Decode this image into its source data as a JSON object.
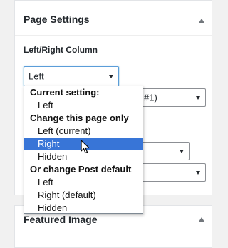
{
  "page_settings": {
    "title": "Page Settings",
    "column_label": "Left/Right Column",
    "column_select_value": "Left",
    "template_select_value": "#1)"
  },
  "dropdown": {
    "groups": [
      {
        "label": "Current setting:",
        "options": [
          {
            "label": "Left",
            "highlighted": false
          }
        ]
      },
      {
        "label": "Change this page only",
        "options": [
          {
            "label": "Left (current)",
            "highlighted": false
          },
          {
            "label": "Right",
            "highlighted": true
          },
          {
            "label": "Hidden",
            "highlighted": false
          }
        ]
      },
      {
        "label": "Or change Post default",
        "options": [
          {
            "label": "Left",
            "highlighted": false
          },
          {
            "label": "Right (default)",
            "highlighted": false
          },
          {
            "label": "Hidden",
            "highlighted": false
          }
        ]
      }
    ]
  },
  "featured_image": {
    "title": "Featured Image"
  },
  "colors": {
    "highlight": "#3875d7",
    "panel_border": "#e2e4e7",
    "background": "#f1f1f1"
  },
  "icons": {
    "panel_toggle": "triangle-up-icon",
    "select_arrow": "chevron-down-icon",
    "cursor": "mouse-pointer-icon"
  }
}
